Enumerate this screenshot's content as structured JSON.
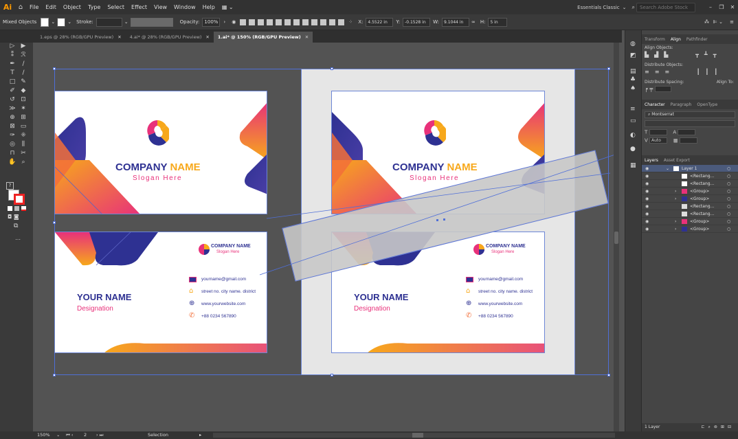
{
  "app": {
    "logo": "Ai",
    "menus": [
      "File",
      "Edit",
      "Object",
      "Type",
      "Select",
      "Effect",
      "View",
      "Window",
      "Help"
    ],
    "workspace": "Essentials Classic",
    "search_placeholder": "Search Adobe Stock"
  },
  "control": {
    "selection_type": "Mixed Objects",
    "stroke_label": "Stroke:",
    "opacity_label": "Opacity:",
    "opacity_value": "100%",
    "x_label": "X:",
    "x_value": "4.5522 in",
    "y_label": "Y:",
    "y_value": "-0.1528 in",
    "w_label": "W:",
    "w_value": "9.1044 in",
    "h_label": "H:",
    "h_value": "5 in"
  },
  "tabs": [
    {
      "label": "1.eps @ 28% (RGB/GPU Preview)",
      "active": false
    },
    {
      "label": "4.ai* @ 28% (RGB/GPU Preview)",
      "active": false
    },
    {
      "label": "1.ai* @ 150% (RGB/GPU Preview)",
      "active": true
    }
  ],
  "card": {
    "company": "COMPANY",
    "name_word": "NAME",
    "slogan": "Slogan Here",
    "your_name": "YOUR NAME",
    "designation": "Designation",
    "email": "yourname@gmail.com",
    "address": "street no. city name. district",
    "website": "www.yourwebsite.com",
    "phone": "+88 0234 567890"
  },
  "colors": {
    "navy": "#2e3192",
    "orange": "#f7a81b",
    "pink": "#e8317a",
    "selection": "#4f6fd8"
  },
  "right_panel": {
    "top_tabs": [
      "Transform",
      "Align",
      "Pathfinder"
    ],
    "align_objects": "Align Objects:",
    "distribute_objects": "Distribute Objects:",
    "distribute_spacing": "Distribute Spacing:",
    "align_to": "Align To:",
    "char_tabs": [
      "Character",
      "Paragraph",
      "OpenType"
    ],
    "font_name": "Montserrat",
    "leading": "Auto",
    "layers_tabs": [
      "Layers",
      "Asset Export"
    ],
    "layers": [
      {
        "name": "Layer 1",
        "indent": 0,
        "expand": true
      },
      {
        "name": "<Rectang...",
        "indent": 1,
        "expand": false
      },
      {
        "name": "<Rectang...",
        "indent": 1,
        "expand": false
      },
      {
        "name": "<Group>",
        "indent": 1,
        "expand": true
      },
      {
        "name": "<Group>",
        "indent": 1,
        "expand": true
      },
      {
        "name": "<Rectang...",
        "indent": 1,
        "expand": false
      },
      {
        "name": "<Rectang...",
        "indent": 1,
        "expand": false
      },
      {
        "name": "<Group>",
        "indent": 1,
        "expand": true
      },
      {
        "name": "<Group>",
        "indent": 1,
        "expand": true
      }
    ],
    "layer_count": "1 Layer"
  },
  "status": {
    "zoom": "150%",
    "artboard": "2",
    "tool": "Selection"
  }
}
